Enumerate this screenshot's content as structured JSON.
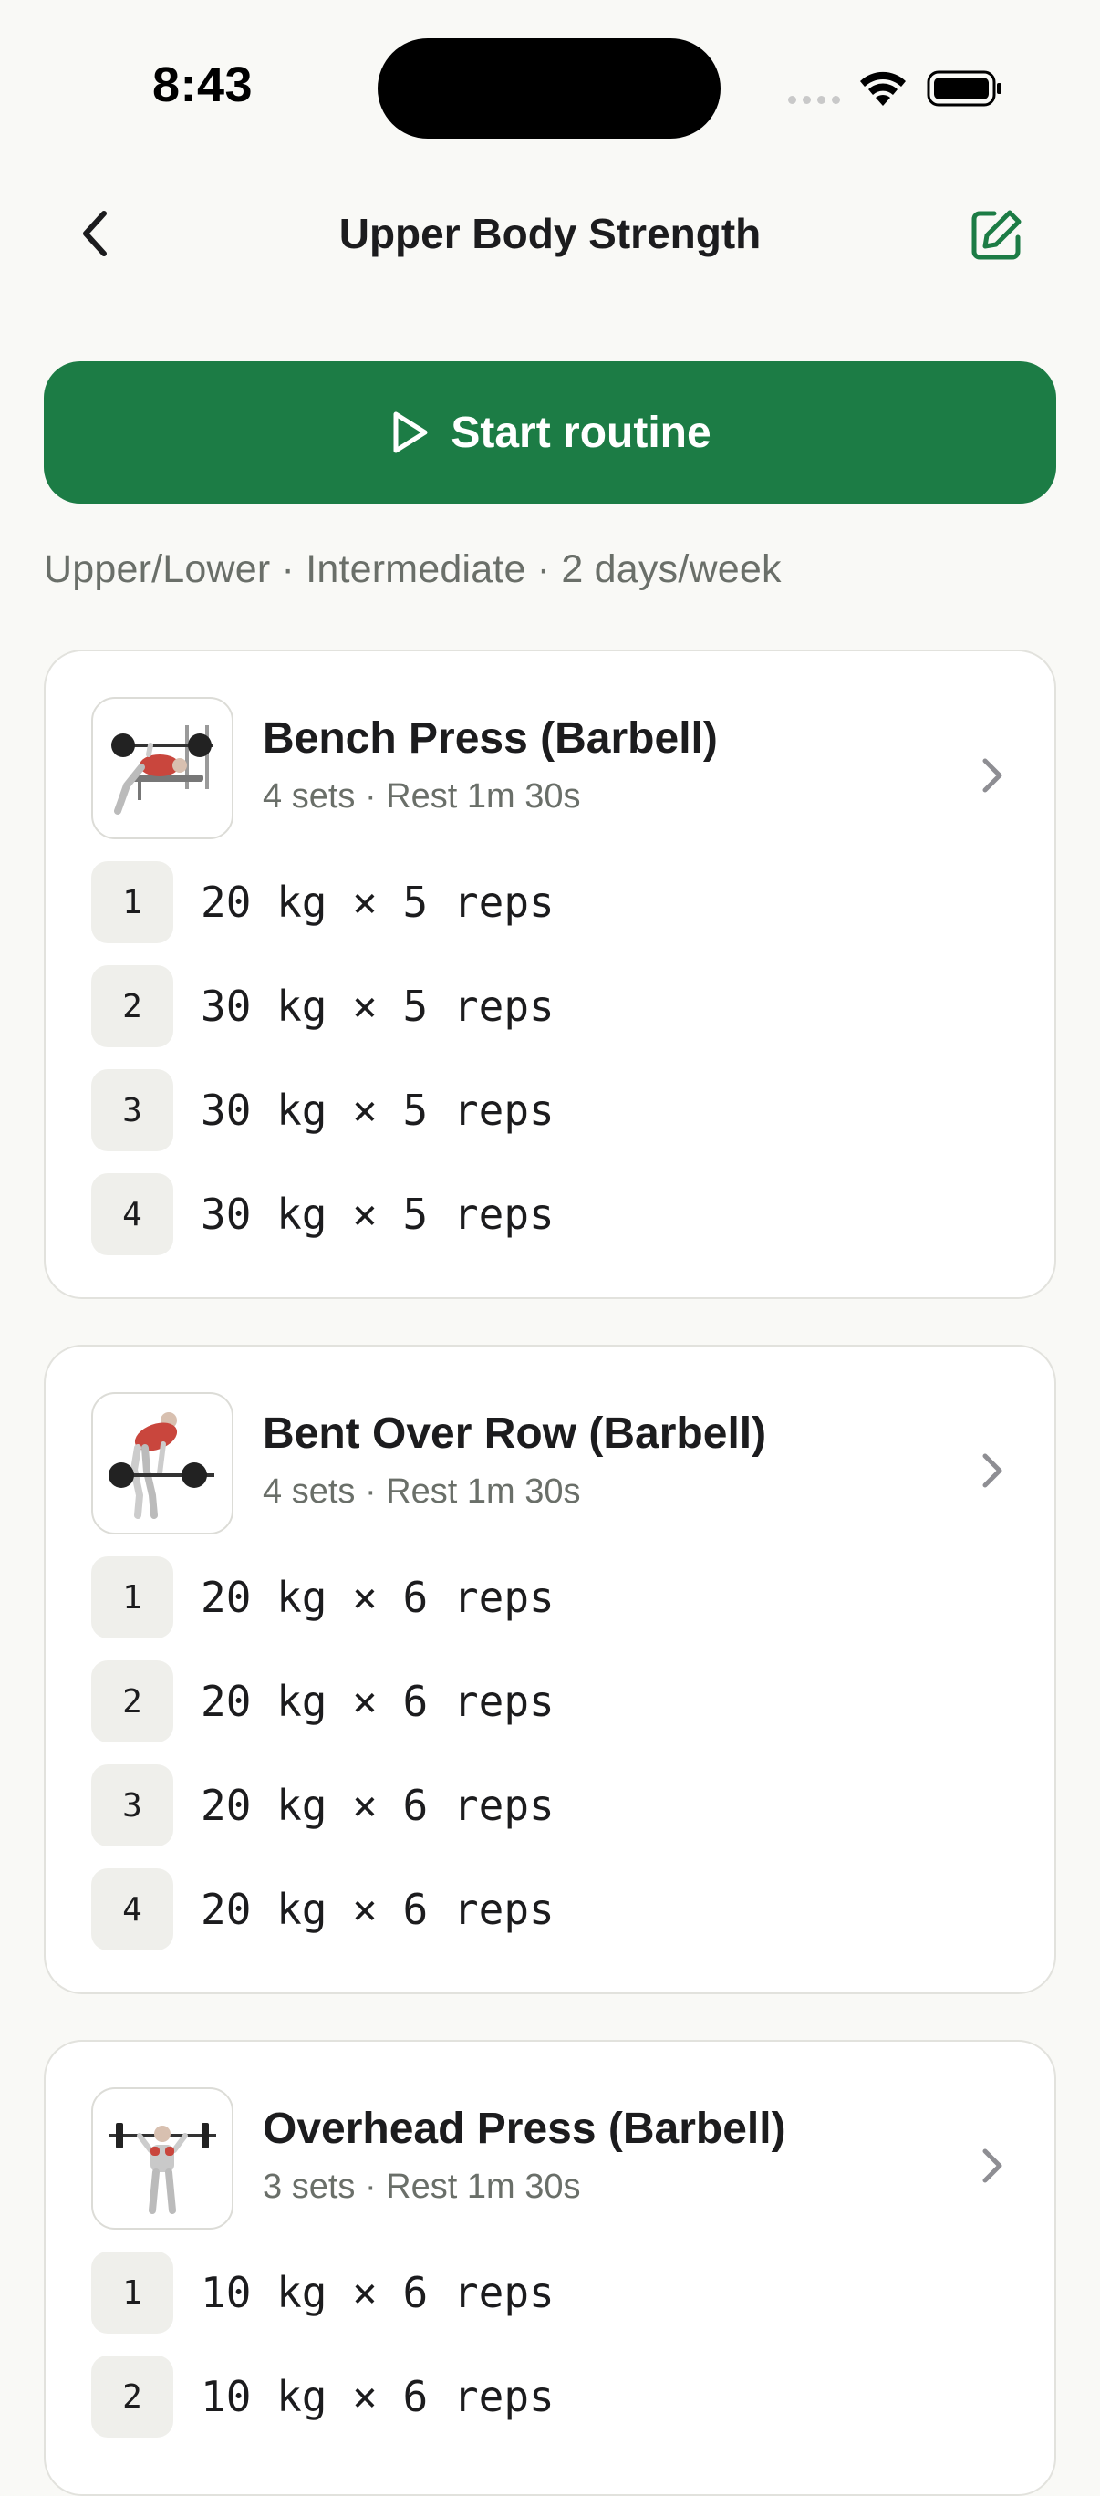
{
  "status_bar": {
    "time": "8:43"
  },
  "nav": {
    "title": "Upper Body Strength"
  },
  "start_button": {
    "label": "Start routine"
  },
  "meta": "Upper/Lower · Intermediate · 2 days/week",
  "colors": {
    "accent": "#1c7c45",
    "background": "#f9f9f6",
    "muted_text": "#6a6f69"
  },
  "exercises": [
    {
      "name": "Bench Press (Barbell)",
      "summary": "4 sets · Rest 1m 30s",
      "icon": "bench-press-illustration",
      "sets": [
        {
          "num": "1",
          "text": "20 kg × 5 reps"
        },
        {
          "num": "2",
          "text": "30 kg × 5 reps"
        },
        {
          "num": "3",
          "text": "30 kg × 5 reps"
        },
        {
          "num": "4",
          "text": "30 kg × 5 reps"
        }
      ]
    },
    {
      "name": "Bent Over Row (Barbell)",
      "summary": "4 sets · Rest 1m 30s",
      "icon": "bent-over-row-illustration",
      "sets": [
        {
          "num": "1",
          "text": "20 kg × 6 reps"
        },
        {
          "num": "2",
          "text": "20 kg × 6 reps"
        },
        {
          "num": "3",
          "text": "20 kg × 6 reps"
        },
        {
          "num": "4",
          "text": "20 kg × 6 reps"
        }
      ]
    },
    {
      "name": "Overhead Press (Barbell)",
      "summary": "3 sets · Rest 1m 30s",
      "icon": "overhead-press-illustration",
      "sets": [
        {
          "num": "1",
          "text": "10 kg × 6 reps"
        },
        {
          "num": "2",
          "text": "10 kg × 6 reps"
        }
      ]
    }
  ]
}
